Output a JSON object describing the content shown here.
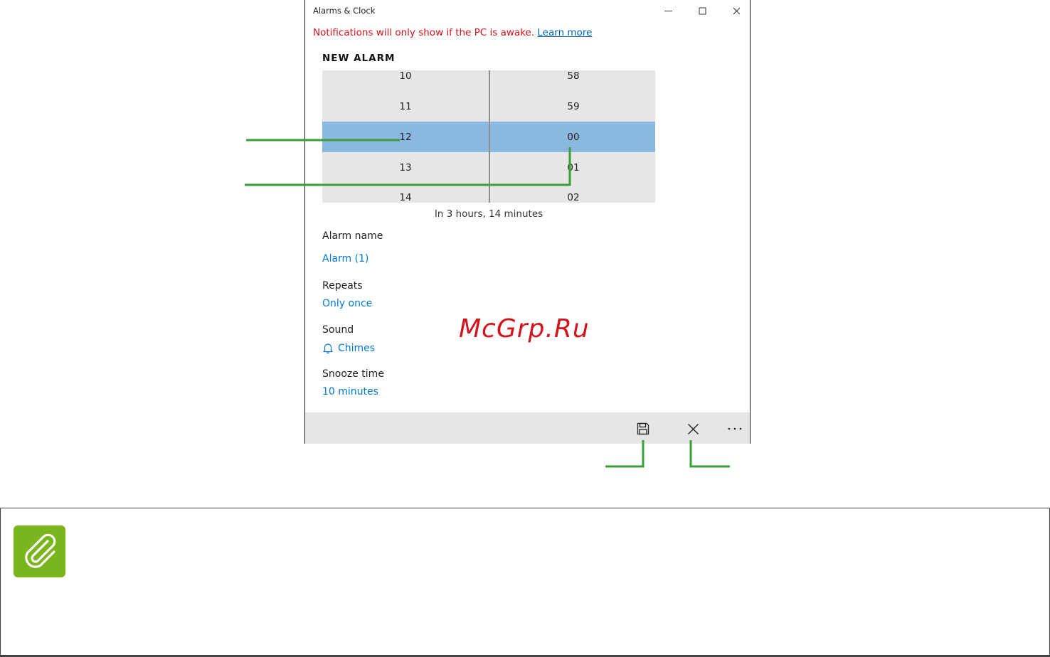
{
  "window": {
    "title": "Alarms & Clock",
    "controls": {
      "minimize": "minimize-icon",
      "maximize": "maximize-icon",
      "close": "close-icon"
    }
  },
  "notice": {
    "text": "Notifications will only show if the PC is awake. ",
    "link": "Learn more",
    "color": "#d4141b"
  },
  "heading": "NEW ALARM",
  "picker": {
    "hours": [
      "10",
      "11",
      "12",
      "13",
      "14"
    ],
    "minutes": [
      "58",
      "59",
      "00",
      "01",
      "02"
    ],
    "selected_hour": "12",
    "selected_minute": "00",
    "highlight_color": "#8ab8e0"
  },
  "countdown": "In 3 hours, 14 minutes",
  "fields": {
    "alarm_name": {
      "label": "Alarm name",
      "value": "Alarm (1)"
    },
    "repeats": {
      "label": "Repeats",
      "value": "Only once"
    },
    "sound": {
      "label": "Sound",
      "value": "Chimes",
      "icon": "bell-icon"
    },
    "snooze": {
      "label": "Snooze time",
      "value": "10 minutes"
    }
  },
  "command_bar": {
    "save": "save-icon",
    "discard": "close-icon",
    "more": "more-icon"
  },
  "watermark": "McGrp.Ru",
  "note": {
    "icon": "paperclip-icon",
    "accent": "#7ab51d"
  },
  "link_color": "#0078d4",
  "callout_color": "#3a9e3a"
}
